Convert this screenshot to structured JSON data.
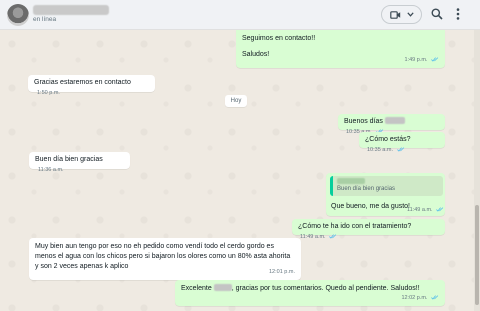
{
  "header": {
    "status": "en línea"
  },
  "day_separator": "Hoy",
  "messages": {
    "m1": {
      "lines": [
        "Seguimos en contacto!!",
        "Saludos!"
      ],
      "time": "1:49 p.m."
    },
    "m2": {
      "text": "Gracias estaremos en contacto",
      "time": "1:50 p.m."
    },
    "m3": {
      "text": "Buenos días",
      "time": "10:35 a.m."
    },
    "m4": {
      "text": "¿Cómo estás?",
      "time": "10:35 a.m."
    },
    "m5": {
      "text": "Buen día bien gracias",
      "time": "11:36 a.m."
    },
    "m6": {
      "quote_text": "Buen día bien gracias",
      "text": "Que bueno, me da gusto!",
      "time": "11:49 a.m."
    },
    "m7": {
      "text": "¿Cómo te ha ido con el tratamiento?",
      "time": "11:49 a.m."
    },
    "m8": {
      "text": "Muy bien aun tengo por eso no eh pedido como vendí todo el cerdo  gordo es menos el agua con los chicos pero si bajaron los olores como un 80% asta ahorita y son 2 veces apenas k aplico",
      "time": "12:01 p.m."
    },
    "m9": {
      "text_before": "Excelente",
      "text_after": ", gracias por tus comentarios. Quedo al pendiente. Saludos!!",
      "time": "12:02 p.m."
    }
  },
  "colors": {
    "incoming_bubble": "#ffffff",
    "outgoing_bubble": "#d9fdd3",
    "read_tick": "#53bdeb",
    "chat_background": "#efeae2"
  },
  "icons": [
    "video-camera-icon",
    "chevron-down-icon",
    "search-icon",
    "kebab-menu-icon",
    "double-check-icon"
  ]
}
